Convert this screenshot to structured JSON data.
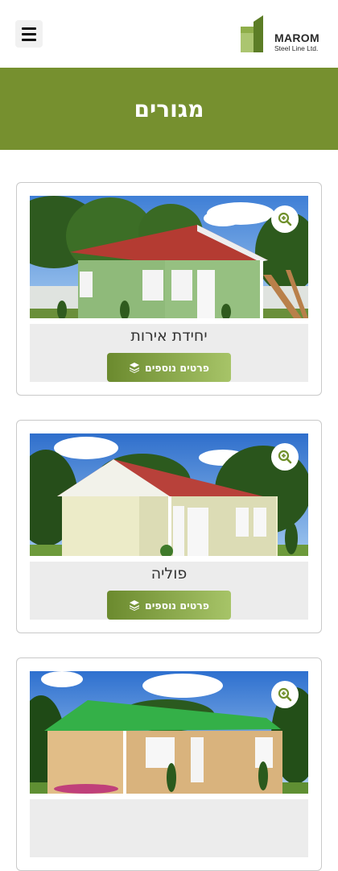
{
  "header": {
    "logo_name": "MAROM",
    "logo_sub": "Steel Line Ltd.",
    "menu_icon": "hamburger-icon"
  },
  "banner": {
    "title": "מגורים"
  },
  "colors": {
    "brand_green": "#76902f",
    "button_start": "#6b8a2e",
    "button_end": "#a7c468"
  },
  "products": [
    {
      "title": "יחידת אירות",
      "button": "פרטים נוספים",
      "button_icon": "layers-icon",
      "zoom_icon": "zoom-in-icon"
    },
    {
      "title": "פוליה",
      "button": "פרטים נוספים",
      "button_icon": "layers-icon",
      "zoom_icon": "zoom-in-icon"
    },
    {
      "title": "",
      "button": "",
      "button_icon": "layers-icon",
      "zoom_icon": "zoom-in-icon"
    }
  ]
}
